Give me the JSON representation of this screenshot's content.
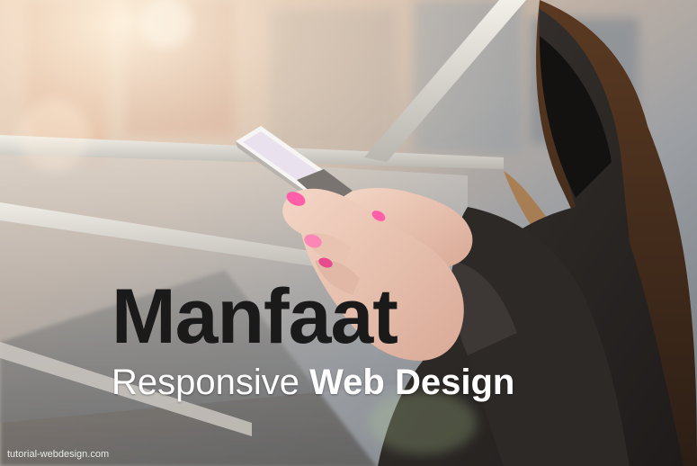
{
  "overlay": {
    "headline": "Manfaat",
    "subheadline_light": "Responsive",
    "subheadline_bold": "Web Design",
    "watermark": "tutorial-webdesign.com"
  },
  "colors": {
    "headline": "#1a1a1a",
    "subheadline": "#ffffff",
    "coat": "#2a2624",
    "nail_polish": "#ff5fa8"
  },
  "photo": {
    "subject": "woman in dark coat using a smartphone on a bridge",
    "icons": [
      "smartphone-icon"
    ]
  }
}
